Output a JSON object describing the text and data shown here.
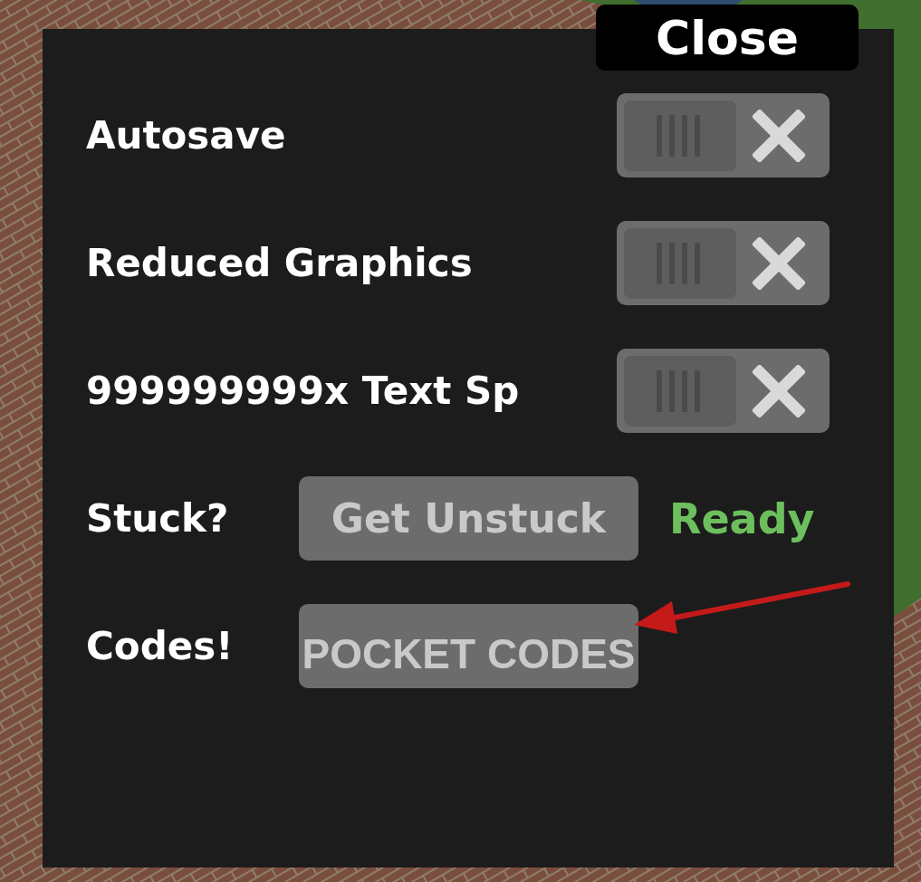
{
  "close_button": "Close",
  "settings": [
    {
      "kind": "toggle",
      "label": "Autosave",
      "on": false
    },
    {
      "kind": "toggle",
      "label": "Reduced Graphics",
      "on": false
    },
    {
      "kind": "toggle",
      "label": "999999999x Text Sp",
      "on": false
    },
    {
      "kind": "action",
      "label": "Stuck?",
      "button": "Get Unstuck",
      "status": "Ready"
    },
    {
      "kind": "codes",
      "label": "Codes!",
      "button": "POCKET CODES"
    }
  ]
}
